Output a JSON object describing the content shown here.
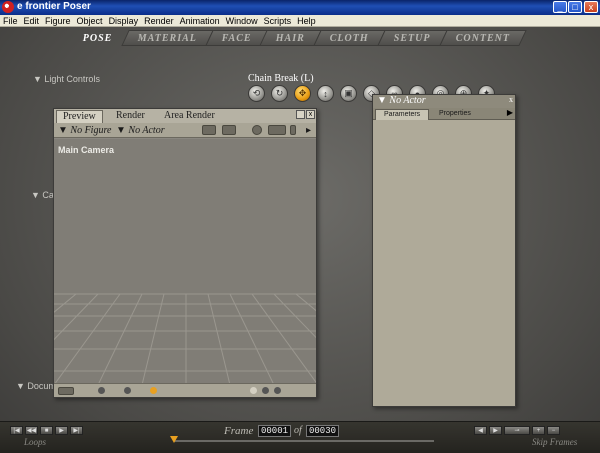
{
  "window": {
    "title": "e frontier Poser",
    "minimize": "_",
    "maximize": "□",
    "close": "x"
  },
  "menu": [
    "File",
    "Edit",
    "Figure",
    "Object",
    "Display",
    "Render",
    "Animation",
    "Window",
    "Scripts",
    "Help"
  ],
  "rooms": [
    "POSE",
    "MATERIAL",
    "FACE",
    "HAIR",
    "CLOTH",
    "SETUP",
    "CONTENT"
  ],
  "active_room": "POSE",
  "light_controls": "▼ Light Controls",
  "chain_break": "Chain Break (L)",
  "side_labels": {
    "camera": "▼ Ca",
    "document": "▼ Docum"
  },
  "preview": {
    "tabs": [
      "Preview",
      "Render",
      "Area Render"
    ],
    "figure": "▼ No Figure",
    "actor": "▼ No Actor",
    "camera": "Main Camera"
  },
  "params": {
    "actor": "▼ No Actor",
    "tabs": [
      "Parameters",
      "Properties"
    ]
  },
  "animation": {
    "frame_label": "Frame",
    "current_frame": "00001",
    "of_label": "of",
    "total_frames": "00030",
    "loops_label": "Loops",
    "skip_frames_label": "Skip Frames",
    "current_position": 0.0
  },
  "colors": {
    "accent": "#e89a10",
    "title_bar": "#0a246a"
  }
}
